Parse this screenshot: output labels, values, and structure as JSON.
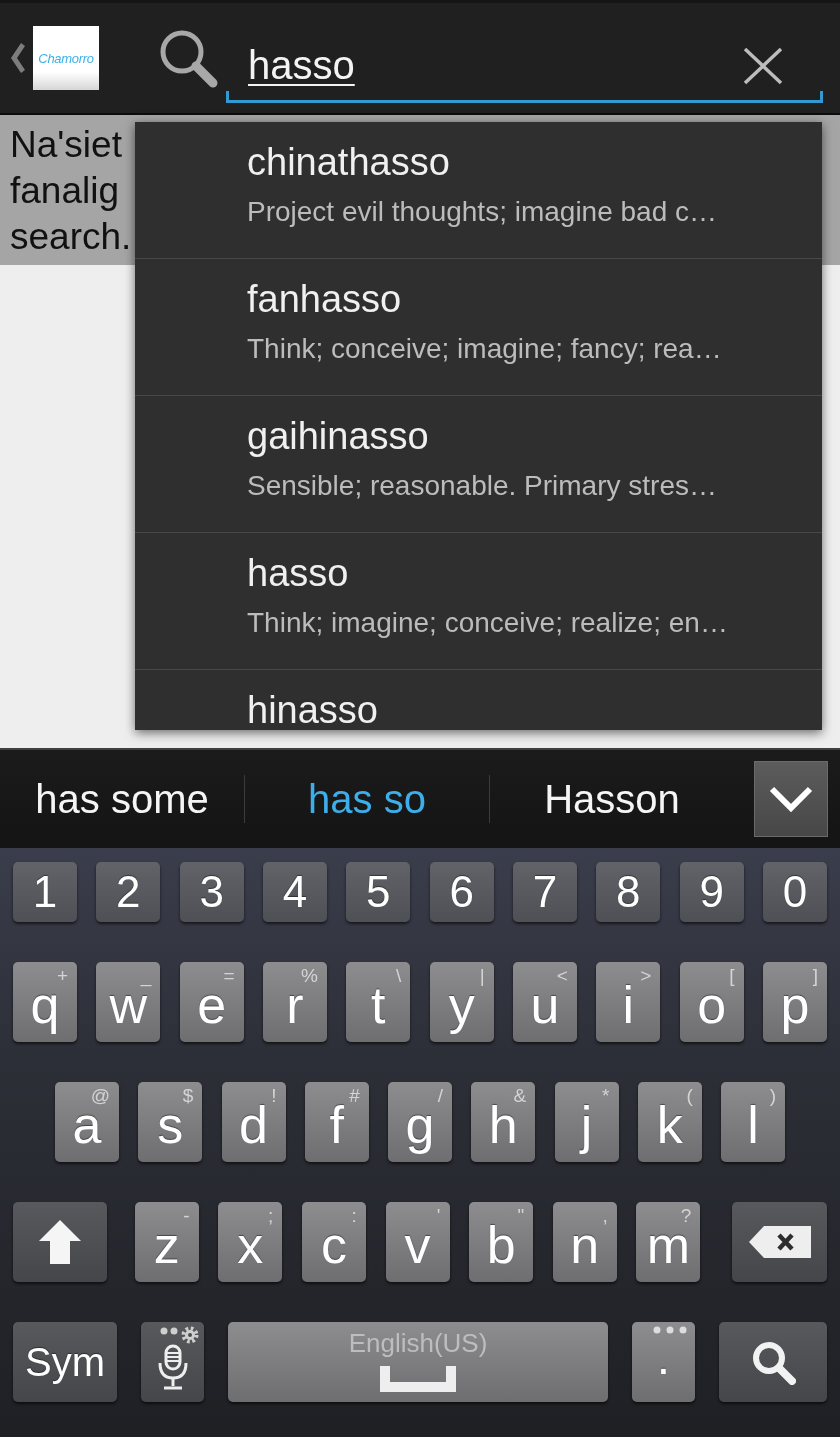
{
  "top_bar": {
    "app_logo": "Chamorro",
    "search": {
      "value": "hasso"
    }
  },
  "content": {
    "lines": [
      "Na'siet",
      "fanalig",
      "search."
    ]
  },
  "search_suggestions": {
    "items": [
      {
        "title": "chinathasso",
        "description": "Project evil thoughts; imagine bad c…"
      },
      {
        "title": "fanhasso",
        "description": "Think; conceive; imagine; fancy; rea…"
      },
      {
        "title": "gaihinasso",
        "description": "Sensible; reasonable. Primary stres…"
      },
      {
        "title": "hasso",
        "description": "Think; imagine; conceive; realize; en…"
      },
      {
        "title": "hinasso"
      }
    ]
  },
  "suggestion_bar": {
    "suggestions": [
      {
        "text": "has some",
        "selected": false
      },
      {
        "text": "has so",
        "selected": true
      },
      {
        "text": "Hasson",
        "selected": false
      }
    ]
  },
  "keyboard": {
    "rows": [
      {
        "keys": [
          {
            "kind": "number",
            "label": "1"
          },
          {
            "kind": "number",
            "label": "2"
          },
          {
            "kind": "number",
            "label": "3"
          },
          {
            "kind": "number",
            "label": "4"
          },
          {
            "kind": "number",
            "label": "5"
          },
          {
            "kind": "number",
            "label": "6"
          },
          {
            "kind": "number",
            "label": "7"
          },
          {
            "kind": "number",
            "label": "8"
          },
          {
            "kind": "number",
            "label": "9"
          },
          {
            "kind": "number",
            "label": "0"
          }
        ]
      },
      {
        "keys": [
          {
            "kind": "letter",
            "label": "q",
            "hint": "+"
          },
          {
            "kind": "letter",
            "label": "w",
            "hint": "_"
          },
          {
            "kind": "letter",
            "label": "e",
            "hint": "="
          },
          {
            "kind": "letter",
            "label": "r",
            "hint": "%"
          },
          {
            "kind": "letter",
            "label": "t",
            "hint": "\\"
          },
          {
            "kind": "letter",
            "label": "y",
            "hint": "|"
          },
          {
            "kind": "letter",
            "label": "u",
            "hint": "<"
          },
          {
            "kind": "letter",
            "label": "i",
            "hint": ">"
          },
          {
            "kind": "letter",
            "label": "o",
            "hint": "["
          },
          {
            "kind": "letter",
            "label": "p",
            "hint": "]"
          }
        ]
      },
      {
        "keys": [
          {
            "kind": "letter",
            "label": "a",
            "hint": "@"
          },
          {
            "kind": "letter",
            "label": "s",
            "hint": "$"
          },
          {
            "kind": "letter",
            "label": "d",
            "hint": "!"
          },
          {
            "kind": "letter",
            "label": "f",
            "hint": "#"
          },
          {
            "kind": "letter",
            "label": "g",
            "hint": "/"
          },
          {
            "kind": "letter",
            "label": "h",
            "hint": "&"
          },
          {
            "kind": "letter",
            "label": "j",
            "hint": "*"
          },
          {
            "kind": "letter",
            "label": "k",
            "hint": "("
          },
          {
            "kind": "letter",
            "label": "l",
            "hint": ")"
          }
        ]
      },
      {
        "keys": [
          {
            "kind": "shift"
          },
          {
            "kind": "letter",
            "label": "z",
            "hint": "-"
          },
          {
            "kind": "letter",
            "label": "x",
            "hint": ";"
          },
          {
            "kind": "letter",
            "label": "c",
            "hint": ":"
          },
          {
            "kind": "letter",
            "label": "v",
            "hint": "'"
          },
          {
            "kind": "letter",
            "label": "b",
            "hint": "\""
          },
          {
            "kind": "letter",
            "label": "n",
            "hint": ","
          },
          {
            "kind": "letter",
            "label": "m",
            "hint": "?"
          },
          {
            "kind": "backspace"
          }
        ]
      },
      {
        "keys": [
          {
            "kind": "sym",
            "label": "Sym"
          },
          {
            "kind": "mic"
          },
          {
            "kind": "space",
            "label": "English(US)"
          },
          {
            "kind": "period",
            "label": "."
          },
          {
            "kind": "search"
          }
        ]
      }
    ]
  }
}
